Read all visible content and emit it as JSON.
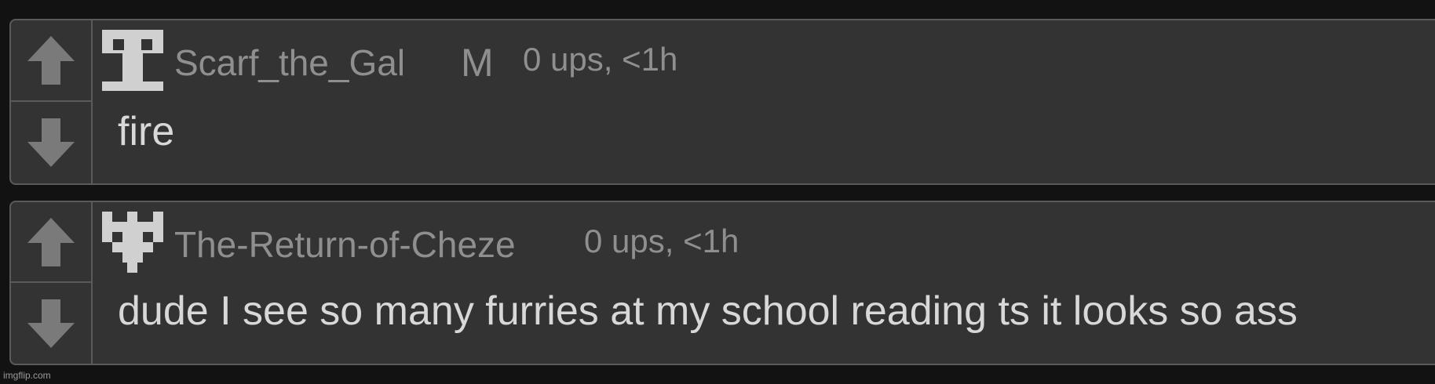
{
  "comments": [
    {
      "username": "Scarf_the_Gal",
      "badge": "M",
      "meta": "0 ups, <1h",
      "text": "fire",
      "avatar_icon": "pixel-totem-icon"
    },
    {
      "username": "The-Return-of-Cheze",
      "badge": "",
      "meta": "0 ups, <1h",
      "text": "dude I see so many furries at my school reading ts it looks so ass",
      "avatar_icon": "pixel-castle-icon"
    }
  ],
  "watermark": "imgflip.com",
  "colors": {
    "background": "#121212",
    "card": "#333333",
    "border": "#5a5a5a",
    "muted_text": "#8f8f8f",
    "body_text": "#d8d8d8",
    "arrow": "#7a7a7a",
    "avatar": "#d0d0d0"
  }
}
